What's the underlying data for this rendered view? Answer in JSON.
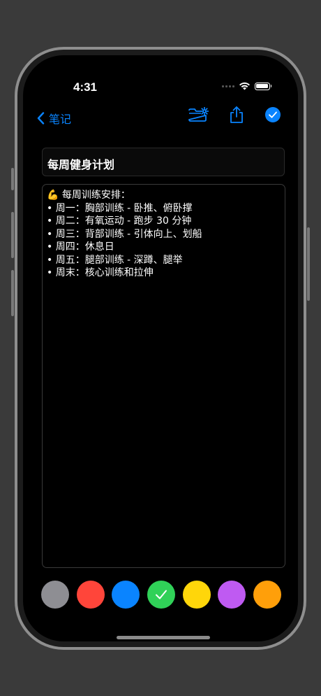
{
  "status_bar": {
    "time": "4:31",
    "icons": [
      "signal-icon",
      "wifi-icon",
      "battery-icon"
    ]
  },
  "nav": {
    "back_label": "笔记",
    "back_icon": "chevron-left-icon",
    "actions": [
      "folder-settings-icon",
      "share-icon",
      "checkmark-circle-icon"
    ],
    "accent_color": "#0a84ff"
  },
  "note": {
    "title": "每周健身计划",
    "content_lines": [
      "💪 每周训练安排：",
      "• 周一：胸部训练 - 卧推、俯卧撑",
      "• 周二：有氧运动 - 跑步 30 分钟",
      "• 周三：背部训练 - 引体向上、划船",
      "• 周四：休息日",
      "• 周五：腿部训练 - 深蹲、腿举",
      "• 周末：核心训练和拉伸"
    ]
  },
  "color_picker": {
    "selected_index": 3,
    "colors": [
      {
        "name": "gray",
        "hex": "#8e8e93"
      },
      {
        "name": "red",
        "hex": "#ff453a"
      },
      {
        "name": "blue",
        "hex": "#0a84ff"
      },
      {
        "name": "green",
        "hex": "#30d158"
      },
      {
        "name": "yellow",
        "hex": "#ffd60a"
      },
      {
        "name": "purple",
        "hex": "#bf5af2"
      },
      {
        "name": "orange",
        "hex": "#ff9f0a"
      }
    ]
  }
}
